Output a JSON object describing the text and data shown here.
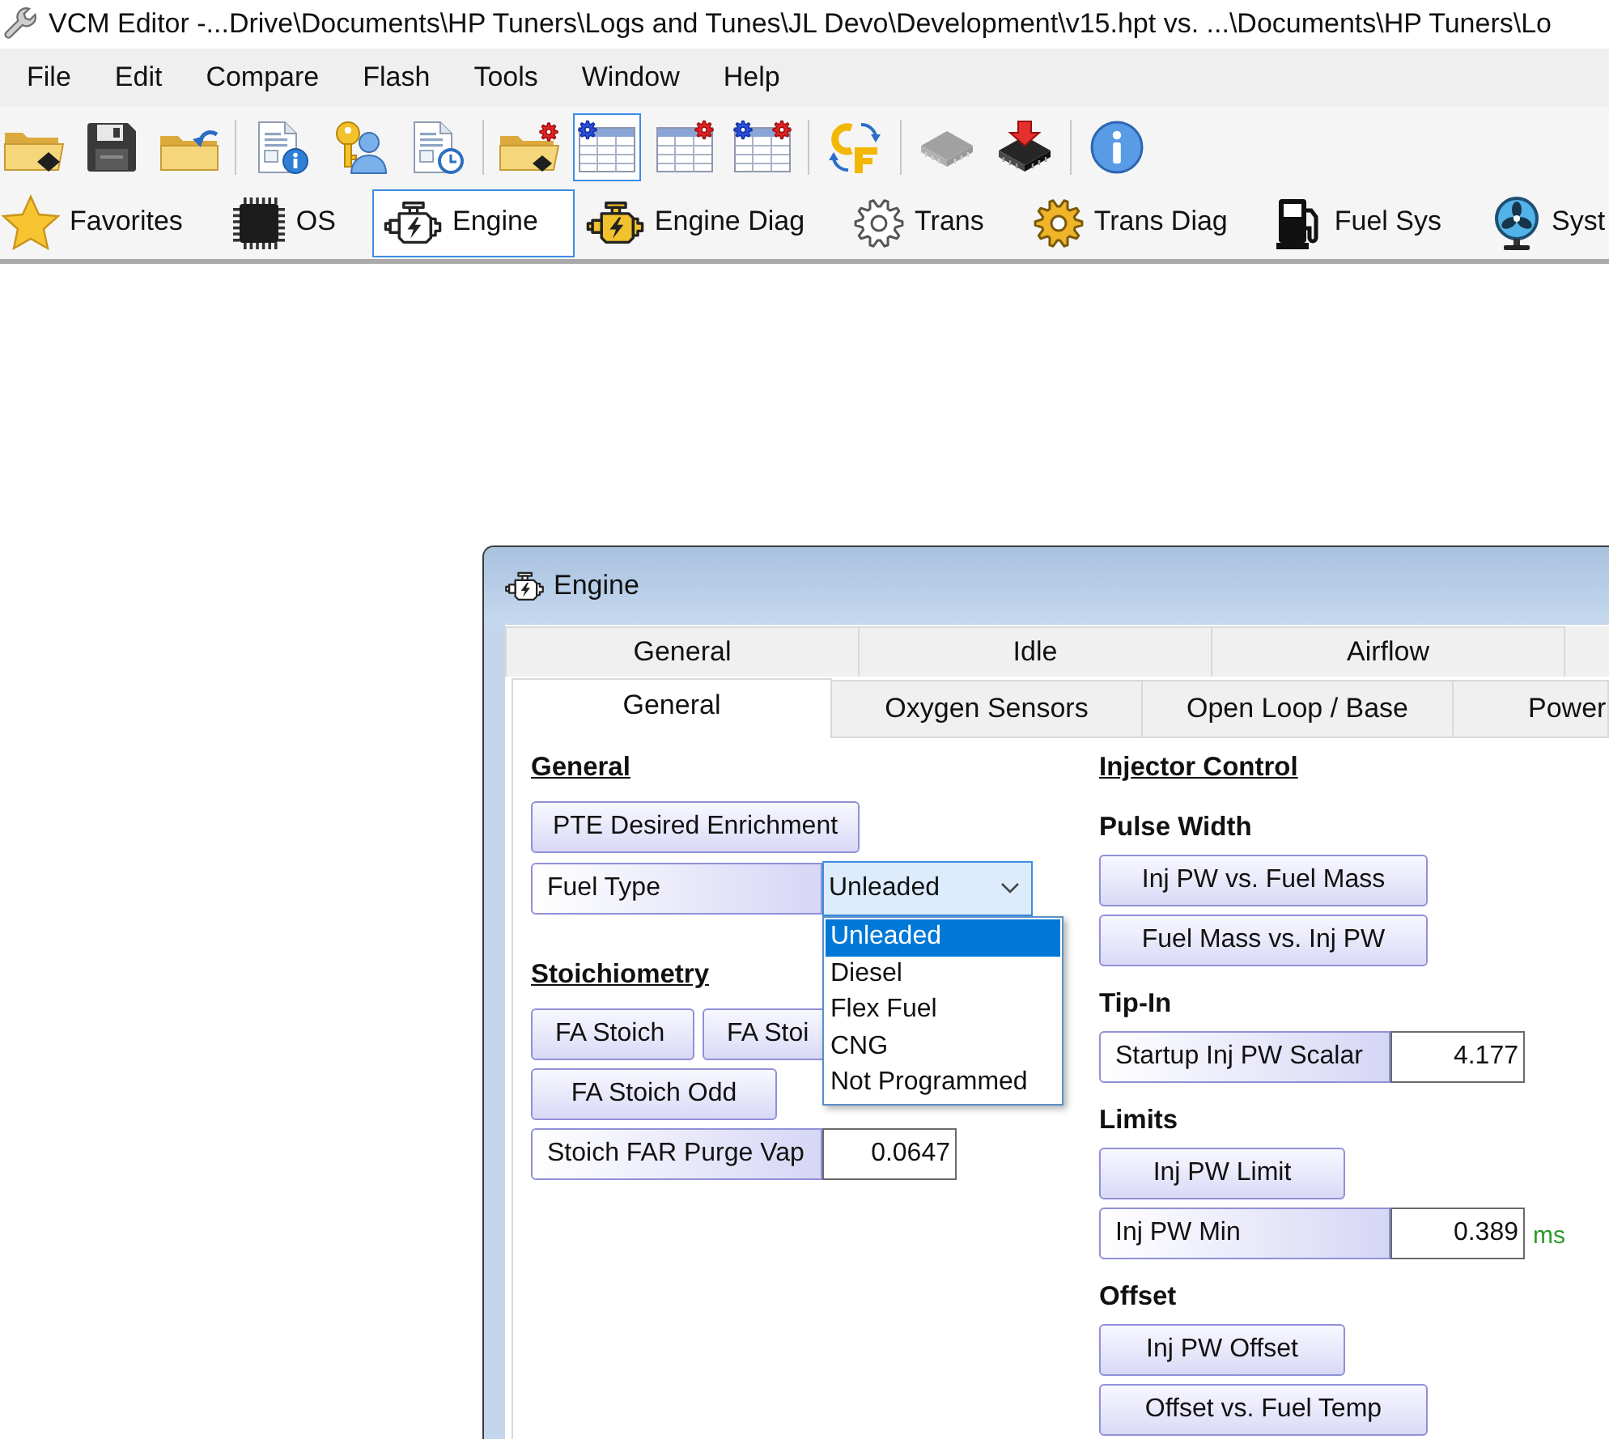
{
  "window": {
    "title": "VCM Editor -...Drive\\Documents\\HP Tuners\\Logs and Tunes\\JL Devo\\Development\\v15.hpt vs. ...\\Documents\\HP Tuners\\Lo"
  },
  "menu": [
    "File",
    "Edit",
    "Compare",
    "Flash",
    "Tools",
    "Window",
    "Help"
  ],
  "toolbar": {
    "groups": [
      {
        "buttons": [
          {
            "selected": false,
            "disabled": false
          },
          {
            "selected": false,
            "disabled": false
          },
          {
            "selected": false,
            "disabled": false
          }
        ]
      },
      {
        "buttons": [
          {
            "selected": false,
            "disabled": false
          },
          {
            "selected": false,
            "disabled": false
          },
          {
            "selected": false,
            "disabled": false
          }
        ]
      },
      {
        "buttons": [
          {
            "selected": false,
            "disabled": false
          },
          {
            "selected": true,
            "disabled": false
          },
          {
            "selected": false,
            "disabled": false
          },
          {
            "selected": false,
            "disabled": false
          }
        ]
      },
      {
        "buttons": [
          {
            "selected": false,
            "disabled": false
          }
        ]
      },
      {
        "buttons": [
          {
            "selected": false,
            "disabled": true
          },
          {
            "selected": false,
            "disabled": false
          }
        ]
      },
      {
        "buttons": [
          {
            "selected": false,
            "disabled": false
          }
        ]
      }
    ]
  },
  "categories": [
    {
      "label": "Favorites",
      "selected": false
    },
    {
      "label": "OS",
      "selected": false
    },
    {
      "label": "Engine",
      "selected": true
    },
    {
      "label": "Engine Diag",
      "selected": false
    },
    {
      "label": "Trans",
      "selected": false
    },
    {
      "label": "Trans Diag",
      "selected": false
    },
    {
      "label": "Fuel Sys",
      "selected": false
    },
    {
      "label": "Syst",
      "selected": false
    }
  ],
  "engine_window": {
    "title": "Engine",
    "tab_rows": [
      {
        "tabs": [
          {
            "label": "General",
            "selected": false
          },
          {
            "label": "Idle",
            "selected": false
          },
          {
            "label": "Airflow",
            "selected": false
          }
        ]
      },
      {
        "tabs": [
          {
            "label": "General",
            "selected": true
          },
          {
            "label": "Oxygen Sensors",
            "selected": false
          },
          {
            "label": "Open Loop / Base",
            "selected": false
          },
          {
            "label": "Power",
            "selected": false
          }
        ]
      }
    ],
    "columns": [
      {
        "items": [
          {
            "kind": "heading",
            "text": "General"
          },
          {
            "kind": "button",
            "label": "PTE Desired Enrichment"
          },
          {
            "kind": "dropdown",
            "label": "Fuel Type",
            "value": "Unleaded",
            "expanded": true,
            "options": [
              {
                "label": "Unleaded",
                "selected": true
              },
              {
                "label": "Diesel",
                "selected": false
              },
              {
                "label": "Flex Fuel",
                "selected": false
              },
              {
                "label": "CNG",
                "selected": false
              },
              {
                "label": "Not Programmed",
                "selected": false
              }
            ]
          },
          {
            "kind": "heading",
            "text": "Stoichiometry"
          },
          {
            "kind": "buttons",
            "labels": [
              "FA Stoich",
              "FA Stoi"
            ]
          },
          {
            "kind": "button",
            "label": "FA Stoich Odd"
          },
          {
            "kind": "value",
            "label": "Stoich FAR Purge Vap",
            "value": "0.0647"
          }
        ]
      },
      {
        "items": [
          {
            "kind": "heading",
            "text": "Injector Control"
          },
          {
            "kind": "subheading",
            "text": "Pulse Width"
          },
          {
            "kind": "button",
            "label": "Inj PW vs. Fuel Mass"
          },
          {
            "kind": "button",
            "label": "Fuel Mass vs. Inj PW"
          },
          {
            "kind": "subheading",
            "text": "Tip-In"
          },
          {
            "kind": "value",
            "label": "Startup Inj PW Scalar",
            "value": "4.177"
          },
          {
            "kind": "subheading",
            "text": "Limits"
          },
          {
            "kind": "button",
            "label": "Inj PW Limit"
          },
          {
            "kind": "value",
            "label": "Inj PW Min",
            "value": "0.389",
            "unit": "ms"
          },
          {
            "kind": "subheading",
            "text": "Offset"
          },
          {
            "kind": "button",
            "label": "Inj PW Offset"
          },
          {
            "kind": "button",
            "label": "Offset vs. Fuel Temp"
          }
        ]
      }
    ]
  }
}
